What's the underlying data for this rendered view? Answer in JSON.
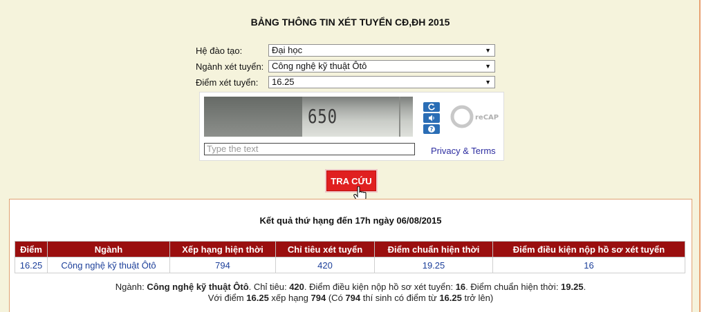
{
  "page_title": "BẢNG THÔNG TIN XÉT TUYỂN CĐ,ĐH 2015",
  "form": {
    "he_dao_tao": {
      "label": "Hệ đào tạo:",
      "value": "Đại học"
    },
    "nganh_xet_tuyen": {
      "label": "Ngành xét tuyển:",
      "value": "Công nghệ kỹ thuật Ôtô"
    },
    "diem_xet_tuyen": {
      "label": "Điểm xét tuyển:",
      "value": "16.25"
    },
    "dropdown_arrow": "▼"
  },
  "captcha": {
    "code": "650",
    "input_placeholder": "Type the text",
    "privacy_terms": "Privacy & Terms",
    "logo_text": "reCAPTCHA",
    "brand_color": "#2a6db5"
  },
  "submit_label": "TRA CỨU",
  "results": {
    "title": "Kết quả thứ hạng đến 17h ngày 06/08/2015",
    "columns": [
      "Điểm",
      "Ngành",
      "Xếp hạng hiện thời",
      "Chỉ tiêu xét tuyển",
      "Điểm chuẩn hiện thời",
      "Điểm điều kiện nộp hồ sơ xét tuyển"
    ],
    "rows": [
      [
        "16.25",
        "Công nghệ kỹ thuật Ôtô",
        "794",
        "420",
        "19.25",
        "16"
      ]
    ],
    "summary": {
      "l1_p1": "Ngành: ",
      "l1_nganh": "Công nghệ kỹ thuật Ôtô",
      "l1_p2": ". Chỉ tiêu: ",
      "l1_chitieu": "420",
      "l1_p3": ". Điểm điều kiện nộp hồ sơ xét tuyển: ",
      "l1_dieukien": "16",
      "l1_p4": ". Điểm chuẩn hiện thời: ",
      "l1_chuan": "19.25",
      "l1_p5": ".",
      "l2_p1": "Với điểm ",
      "l2_diem": "16.25",
      "l2_p2": " xếp hạng ",
      "l2_hang": "794",
      "l2_p3": " (Có ",
      "l2_count": "794",
      "l2_p4": " thí sinh có điểm từ ",
      "l2_diem2": "16.25",
      "l2_p5": " trở lên)"
    }
  },
  "colors": {
    "panel_bg": "#f5f3dc",
    "header_bg": "#9a0f0f",
    "button_bg": "#e02020",
    "link": "#1c3f9a"
  }
}
